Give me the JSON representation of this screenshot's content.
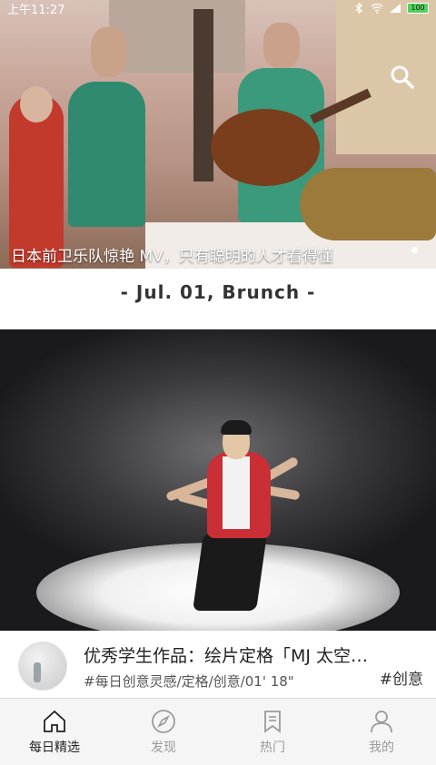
{
  "status_bar": {
    "time": "上午11:27",
    "battery": "100"
  },
  "banner": {
    "caption": "日本前卫乐队惊艳 MV，只有聪明的人才看得懂",
    "slides": 2,
    "active_slide": 2
  },
  "feed": {
    "date_heading": "- Jul. 01, Brunch -"
  },
  "video": {
    "title": "优秀学生作品：绘片定格「MJ 太空步」",
    "meta": "#每日创意灵感/定格/创意/01' 18\"",
    "tag": "#创意"
  },
  "nav": [
    {
      "label": "每日精选",
      "icon": "home-icon",
      "active": true
    },
    {
      "label": "发现",
      "icon": "compass-icon",
      "active": false
    },
    {
      "label": "热门",
      "icon": "bookmark-icon",
      "active": false
    },
    {
      "label": "我的",
      "icon": "person-icon",
      "active": false
    }
  ]
}
